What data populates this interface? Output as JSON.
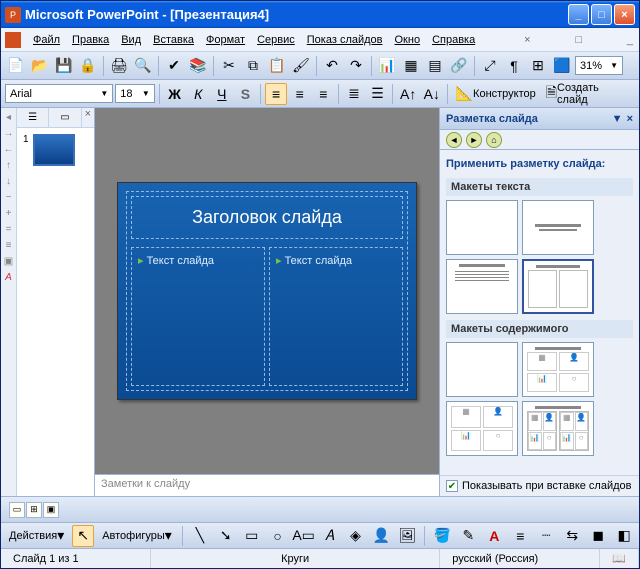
{
  "title": "Microsoft PowerPoint - [Презентация4]",
  "menu": [
    "Файл",
    "Правка",
    "Вид",
    "Вставка",
    "Формат",
    "Сервис",
    "Показ слайдов",
    "Окно",
    "Справка"
  ],
  "zoom": "31%",
  "font": {
    "family": "Arial",
    "size": "18"
  },
  "formatToolbar": {
    "constructor": "Конструктор",
    "newSlide": "Создать слайд"
  },
  "thumb": {
    "num": "1"
  },
  "slide": {
    "title": "Заголовок слайда",
    "col1": "Текст слайда",
    "col2": "Текст слайда"
  },
  "notes": "Заметки к слайду",
  "taskPane": {
    "title": "Разметка слайда",
    "apply": "Применить разметку слайда:",
    "g1": "Макеты текста",
    "g2": "Макеты содержимого",
    "showOnInsert": "Показывать при вставке слайдов"
  },
  "drawingBar": {
    "actions": "Действия",
    "autoshapes": "Автофигуры"
  },
  "status": {
    "slide": "Слайд 1 из 1",
    "design": "Круги",
    "lang": "русский (Россия)"
  }
}
